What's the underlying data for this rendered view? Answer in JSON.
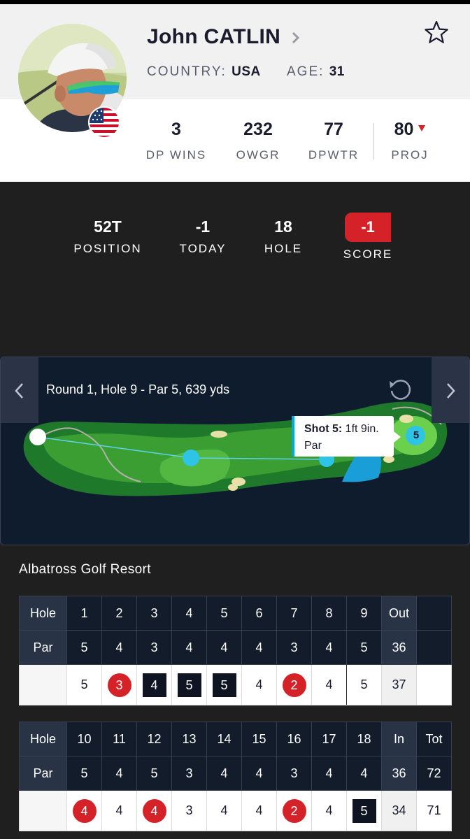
{
  "player": {
    "name": "John CATLIN",
    "country_label": "COUNTRY:",
    "country": "USA",
    "age_label": "AGE:",
    "age": "31"
  },
  "stats": [
    {
      "value": "3",
      "label": "DP WINS"
    },
    {
      "value": "232",
      "label": "OWGR"
    },
    {
      "value": "77",
      "label": "DPWTR"
    },
    {
      "value": "80",
      "label": "PROJ",
      "trend": "down"
    }
  ],
  "summary": {
    "position": {
      "value": "52T",
      "label": "POSITION"
    },
    "today": {
      "value": "-1",
      "label": "TODAY"
    },
    "hole": {
      "value": "18",
      "label": "HOLE"
    },
    "score": {
      "value": "-1",
      "label": "SCORE"
    }
  },
  "map": {
    "title": "Round 1, Hole 9 - Par 5, 639 yds",
    "tooltip_shot": "Shot 5:",
    "tooltip_distance": "1ft 9in.",
    "tooltip_result": "Par",
    "shot_marker": "5"
  },
  "course_name": "Albatross Golf Resort",
  "front_nine": {
    "hole_label": "Hole",
    "par_label": "Par",
    "holes": [
      "1",
      "2",
      "3",
      "4",
      "5",
      "6",
      "7",
      "8",
      "9"
    ],
    "total_label": "Out",
    "pars": [
      "5",
      "4",
      "3",
      "4",
      "4",
      "4",
      "3",
      "4",
      "5"
    ],
    "par_total": "36",
    "scores": [
      "5",
      "3",
      "4",
      "5",
      "5",
      "4",
      "2",
      "4",
      "5"
    ],
    "score_total": "37"
  },
  "back_nine": {
    "hole_label": "Hole",
    "par_label": "Par",
    "holes": [
      "10",
      "11",
      "12",
      "13",
      "14",
      "15",
      "16",
      "17",
      "18"
    ],
    "total_label": "In",
    "grand_label": "Tot",
    "pars": [
      "5",
      "4",
      "5",
      "3",
      "4",
      "4",
      "3",
      "4",
      "4"
    ],
    "par_total": "36",
    "par_grand": "72",
    "scores": [
      "4",
      "4",
      "4",
      "3",
      "4",
      "4",
      "2",
      "4",
      "5"
    ],
    "score_total": "34",
    "score_grand": "71"
  },
  "colors": {
    "accent_red": "#d52228",
    "map_bg": "#0f1c2e",
    "marker_cyan": "#2ec4e6",
    "header_text": "#1b1b2e"
  }
}
